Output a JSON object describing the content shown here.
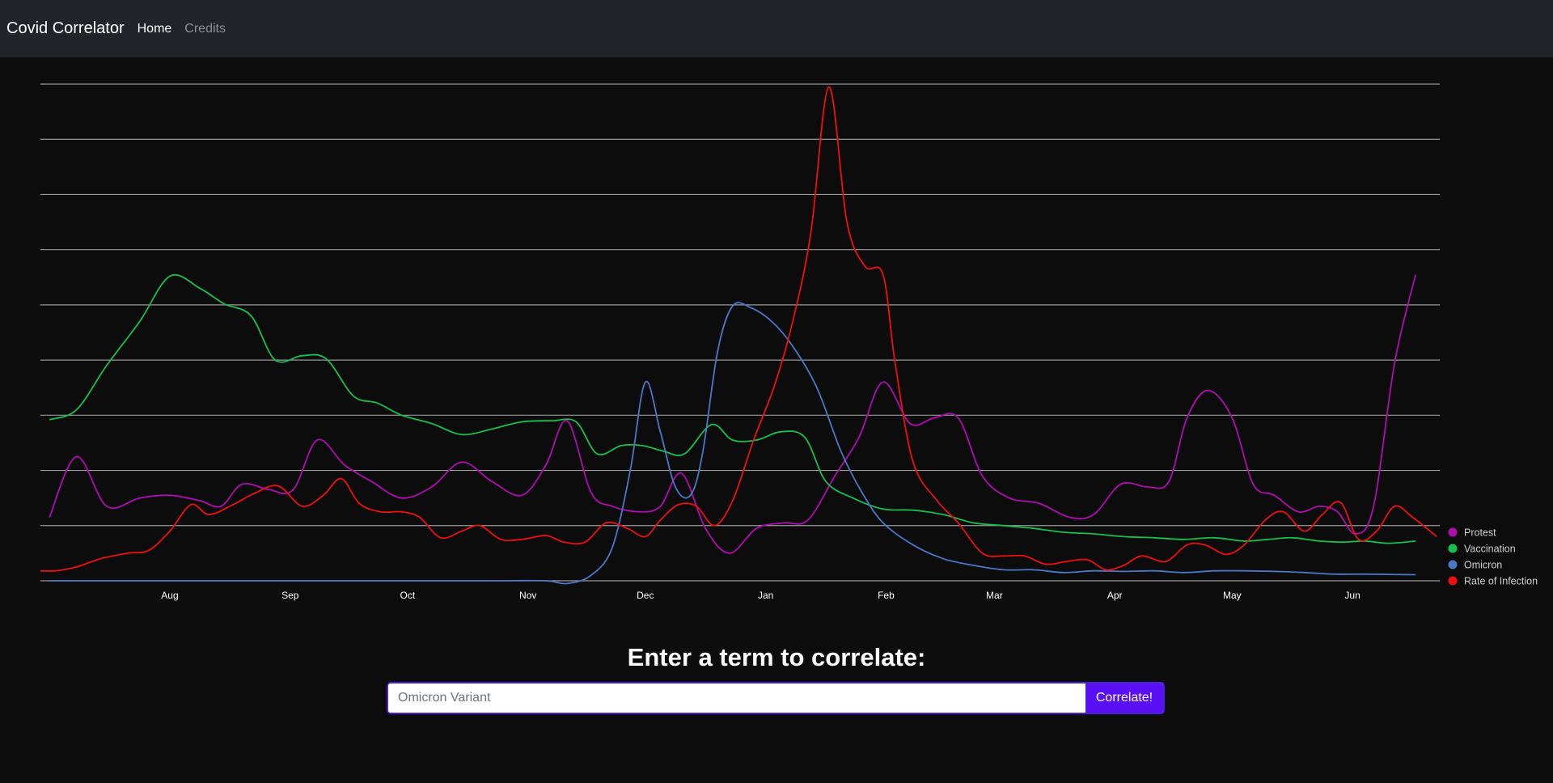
{
  "navbar": {
    "brand": "Covid Correlator",
    "links": [
      {
        "label": "Home",
        "active": true
      },
      {
        "label": "Credits",
        "active": false
      }
    ]
  },
  "chart_data": {
    "type": "line",
    "title": "",
    "xlabel": "",
    "ylabel": "",
    "ylim": [
      0,
      9
    ],
    "grid": true,
    "legend_position": "right-bottom",
    "x_tick_labels": [
      "Aug",
      "Sep",
      "Oct",
      "Nov",
      "Dec",
      "Jan",
      "Feb",
      "Mar",
      "Apr",
      "May",
      "Jun"
    ],
    "x_tick_positions": [
      4.3,
      8.3,
      12.2,
      16.2,
      20.1,
      24.1,
      28.1,
      31.7,
      35.7,
      39.6,
      43.6
    ],
    "x_range": [
      0,
      46.5
    ],
    "series": [
      {
        "name": "Protest",
        "color": "#b10bb1",
        "values": [
          [
            0.3,
            1.15
          ],
          [
            1.2,
            2.25
          ],
          [
            2.2,
            1.35
          ],
          [
            3.3,
            1.5
          ],
          [
            4.3,
            1.55
          ],
          [
            5.3,
            1.45
          ],
          [
            6.0,
            1.35
          ],
          [
            6.7,
            1.75
          ],
          [
            7.6,
            1.65
          ],
          [
            8.4,
            1.65
          ],
          [
            9.2,
            2.55
          ],
          [
            10.1,
            2.1
          ],
          [
            11.0,
            1.8
          ],
          [
            12.0,
            1.5
          ],
          [
            13.0,
            1.7
          ],
          [
            14.0,
            2.15
          ],
          [
            15.0,
            1.8
          ],
          [
            16.0,
            1.55
          ],
          [
            16.8,
            2.1
          ],
          [
            17.5,
            2.9
          ],
          [
            18.3,
            1.6
          ],
          [
            19.0,
            1.35
          ],
          [
            19.9,
            1.25
          ],
          [
            20.6,
            1.35
          ],
          [
            21.3,
            1.95
          ],
          [
            22.1,
            0.95
          ],
          [
            22.9,
            0.5
          ],
          [
            23.8,
            0.95
          ],
          [
            24.7,
            1.05
          ],
          [
            25.5,
            1.1
          ],
          [
            26.4,
            1.9
          ],
          [
            27.2,
            2.6
          ],
          [
            28.0,
            3.6
          ],
          [
            28.9,
            2.85
          ],
          [
            29.7,
            2.95
          ],
          [
            30.5,
            2.95
          ],
          [
            31.3,
            1.9
          ],
          [
            32.2,
            1.5
          ],
          [
            33.2,
            1.4
          ],
          [
            34.2,
            1.15
          ],
          [
            35.0,
            1.2
          ],
          [
            35.9,
            1.75
          ],
          [
            36.8,
            1.7
          ],
          [
            37.5,
            1.8
          ],
          [
            38.1,
            2.95
          ],
          [
            38.8,
            3.45
          ],
          [
            39.6,
            2.95
          ],
          [
            40.3,
            1.75
          ],
          [
            41.0,
            1.55
          ],
          [
            41.8,
            1.25
          ],
          [
            42.5,
            1.35
          ],
          [
            43.1,
            1.25
          ],
          [
            43.7,
            0.85
          ],
          [
            44.3,
            1.35
          ],
          [
            45.0,
            3.95
          ],
          [
            45.7,
            5.55
          ]
        ]
      },
      {
        "name": "Vaccination",
        "color": "#15c14c",
        "values": [
          [
            0.3,
            2.92
          ],
          [
            1.2,
            3.1
          ],
          [
            2.2,
            3.9
          ],
          [
            3.3,
            4.7
          ],
          [
            4.3,
            5.52
          ],
          [
            5.3,
            5.3
          ],
          [
            6.1,
            5.02
          ],
          [
            7.0,
            4.8
          ],
          [
            7.8,
            4.0
          ],
          [
            8.7,
            4.08
          ],
          [
            9.5,
            4.02
          ],
          [
            10.4,
            3.35
          ],
          [
            11.2,
            3.22
          ],
          [
            12.0,
            3.0
          ],
          [
            13.0,
            2.85
          ],
          [
            14.0,
            2.65
          ],
          [
            15.0,
            2.75
          ],
          [
            16.0,
            2.88
          ],
          [
            17.0,
            2.9
          ],
          [
            17.8,
            2.88
          ],
          [
            18.5,
            2.3
          ],
          [
            19.3,
            2.45
          ],
          [
            20.0,
            2.45
          ],
          [
            20.7,
            2.35
          ],
          [
            21.4,
            2.3
          ],
          [
            22.3,
            2.83
          ],
          [
            23.0,
            2.55
          ],
          [
            23.8,
            2.55
          ],
          [
            24.6,
            2.7
          ],
          [
            25.4,
            2.6
          ],
          [
            26.1,
            1.8
          ],
          [
            27.0,
            1.5
          ],
          [
            28.0,
            1.3
          ],
          [
            29.0,
            1.28
          ],
          [
            30.0,
            1.2
          ],
          [
            31.0,
            1.05
          ],
          [
            32.0,
            1.0
          ],
          [
            33.0,
            0.95
          ],
          [
            34.0,
            0.88
          ],
          [
            35.0,
            0.85
          ],
          [
            36.0,
            0.8
          ],
          [
            37.0,
            0.78
          ],
          [
            38.0,
            0.75
          ],
          [
            39.0,
            0.78
          ],
          [
            40.0,
            0.72
          ],
          [
            40.8,
            0.75
          ],
          [
            41.6,
            0.78
          ],
          [
            42.5,
            0.72
          ],
          [
            43.3,
            0.7
          ],
          [
            44.0,
            0.72
          ],
          [
            44.8,
            0.68
          ],
          [
            45.7,
            0.72
          ]
        ]
      },
      {
        "name": "Omicron",
        "color": "#4a78c9",
        "values": [
          [
            0.3,
            0.0
          ],
          [
            5.0,
            0.0
          ],
          [
            10.0,
            0.0
          ],
          [
            15.0,
            0.0
          ],
          [
            16.8,
            0.0
          ],
          [
            17.5,
            -0.05
          ],
          [
            18.3,
            0.1
          ],
          [
            19.0,
            0.6
          ],
          [
            19.6,
            2.0
          ],
          [
            20.1,
            3.6
          ],
          [
            20.6,
            2.7
          ],
          [
            21.1,
            1.7
          ],
          [
            21.6,
            1.55
          ],
          [
            22.0,
            2.3
          ],
          [
            22.5,
            4.15
          ],
          [
            23.0,
            4.98
          ],
          [
            23.6,
            4.95
          ],
          [
            24.3,
            4.7
          ],
          [
            25.0,
            4.25
          ],
          [
            25.8,
            3.5
          ],
          [
            26.6,
            2.35
          ],
          [
            27.3,
            1.6
          ],
          [
            28.0,
            1.05
          ],
          [
            29.0,
            0.65
          ],
          [
            30.0,
            0.4
          ],
          [
            31.0,
            0.28
          ],
          [
            32.0,
            0.2
          ],
          [
            33.0,
            0.2
          ],
          [
            34.0,
            0.15
          ],
          [
            35.0,
            0.18
          ],
          [
            36.0,
            0.17
          ],
          [
            37.0,
            0.18
          ],
          [
            38.0,
            0.15
          ],
          [
            39.0,
            0.18
          ],
          [
            40.0,
            0.18
          ],
          [
            41.0,
            0.17
          ],
          [
            42.0,
            0.15
          ],
          [
            43.0,
            0.12
          ],
          [
            44.0,
            0.12
          ],
          [
            45.7,
            0.11
          ]
        ]
      },
      {
        "name": "Rate of Infection",
        "color": "#f00f0f",
        "values": [
          [
            0.0,
            0.18
          ],
          [
            0.5,
            0.18
          ],
          [
            1.2,
            0.25
          ],
          [
            2.0,
            0.4
          ],
          [
            2.9,
            0.5
          ],
          [
            3.6,
            0.55
          ],
          [
            4.3,
            0.9
          ],
          [
            5.0,
            1.38
          ],
          [
            5.6,
            1.2
          ],
          [
            6.4,
            1.38
          ],
          [
            7.1,
            1.58
          ],
          [
            7.9,
            1.72
          ],
          [
            8.7,
            1.35
          ],
          [
            9.4,
            1.55
          ],
          [
            10.0,
            1.85
          ],
          [
            10.6,
            1.4
          ],
          [
            11.3,
            1.25
          ],
          [
            12.0,
            1.25
          ],
          [
            12.6,
            1.15
          ],
          [
            13.3,
            0.78
          ],
          [
            14.0,
            0.9
          ],
          [
            14.6,
            1.0
          ],
          [
            15.3,
            0.75
          ],
          [
            16.0,
            0.75
          ],
          [
            16.8,
            0.82
          ],
          [
            17.4,
            0.7
          ],
          [
            18.1,
            0.7
          ],
          [
            18.8,
            1.05
          ],
          [
            19.5,
            0.95
          ],
          [
            20.1,
            0.8
          ],
          [
            20.6,
            1.1
          ],
          [
            21.2,
            1.38
          ],
          [
            21.8,
            1.35
          ],
          [
            22.4,
            1.0
          ],
          [
            23.0,
            1.45
          ],
          [
            23.7,
            2.55
          ],
          [
            24.4,
            3.55
          ],
          [
            25.0,
            4.7
          ],
          [
            25.6,
            6.3
          ],
          [
            26.2,
            8.95
          ],
          [
            26.8,
            6.5
          ],
          [
            27.4,
            5.7
          ],
          [
            28.0,
            5.55
          ],
          [
            28.4,
            3.95
          ],
          [
            29.0,
            2.15
          ],
          [
            29.8,
            1.45
          ],
          [
            30.5,
            1.05
          ],
          [
            31.3,
            0.5
          ],
          [
            32.0,
            0.45
          ],
          [
            32.7,
            0.45
          ],
          [
            33.4,
            0.3
          ],
          [
            34.1,
            0.35
          ],
          [
            34.8,
            0.38
          ],
          [
            35.4,
            0.2
          ],
          [
            36.0,
            0.28
          ],
          [
            36.6,
            0.45
          ],
          [
            37.4,
            0.35
          ],
          [
            38.1,
            0.65
          ],
          [
            38.7,
            0.65
          ],
          [
            39.4,
            0.48
          ],
          [
            40.0,
            0.65
          ],
          [
            40.7,
            1.1
          ],
          [
            41.3,
            1.25
          ],
          [
            42.0,
            0.9
          ],
          [
            42.6,
            1.2
          ],
          [
            43.2,
            1.42
          ],
          [
            43.8,
            0.75
          ],
          [
            44.4,
            0.9
          ],
          [
            45.0,
            1.35
          ],
          [
            45.6,
            1.15
          ],
          [
            46.4,
            0.8
          ]
        ]
      }
    ]
  },
  "prompt": {
    "heading": "Enter a term to correlate:"
  },
  "search": {
    "placeholder": "Omicron Variant",
    "button_label": "Correlate!"
  }
}
